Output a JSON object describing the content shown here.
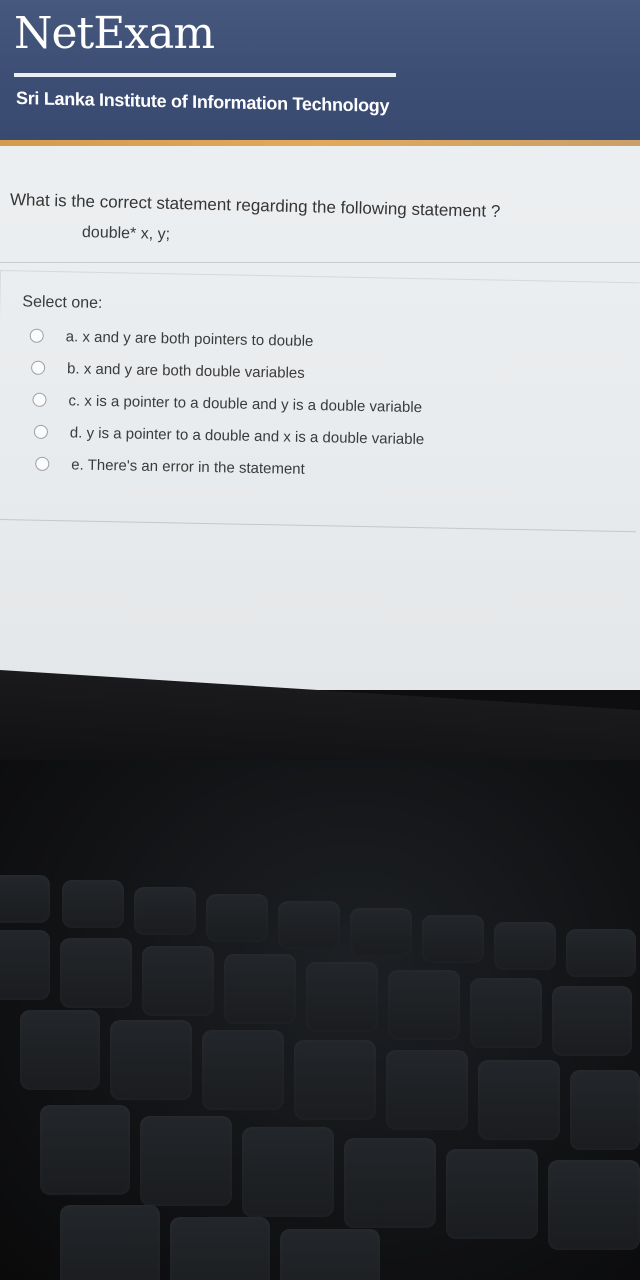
{
  "header": {
    "logo": "NetExam",
    "institute": "Sri Lanka Institute of Information Technology"
  },
  "question": {
    "text": "What is the correct statement regarding the following statement ?",
    "code": "double* x, y;"
  },
  "answers": {
    "prompt": "Select one:",
    "options": [
      "a. x and y are both pointers to double",
      "b. x and y are both double variables",
      "c. x is a pointer to a double and y is a double variable",
      "d. y is a pointer to a double and x is a double variable",
      "e. There's an error in the statement"
    ]
  },
  "colors": {
    "header": "#3c4e74",
    "accent": "#e2a95a",
    "page": "#eef1f3"
  }
}
